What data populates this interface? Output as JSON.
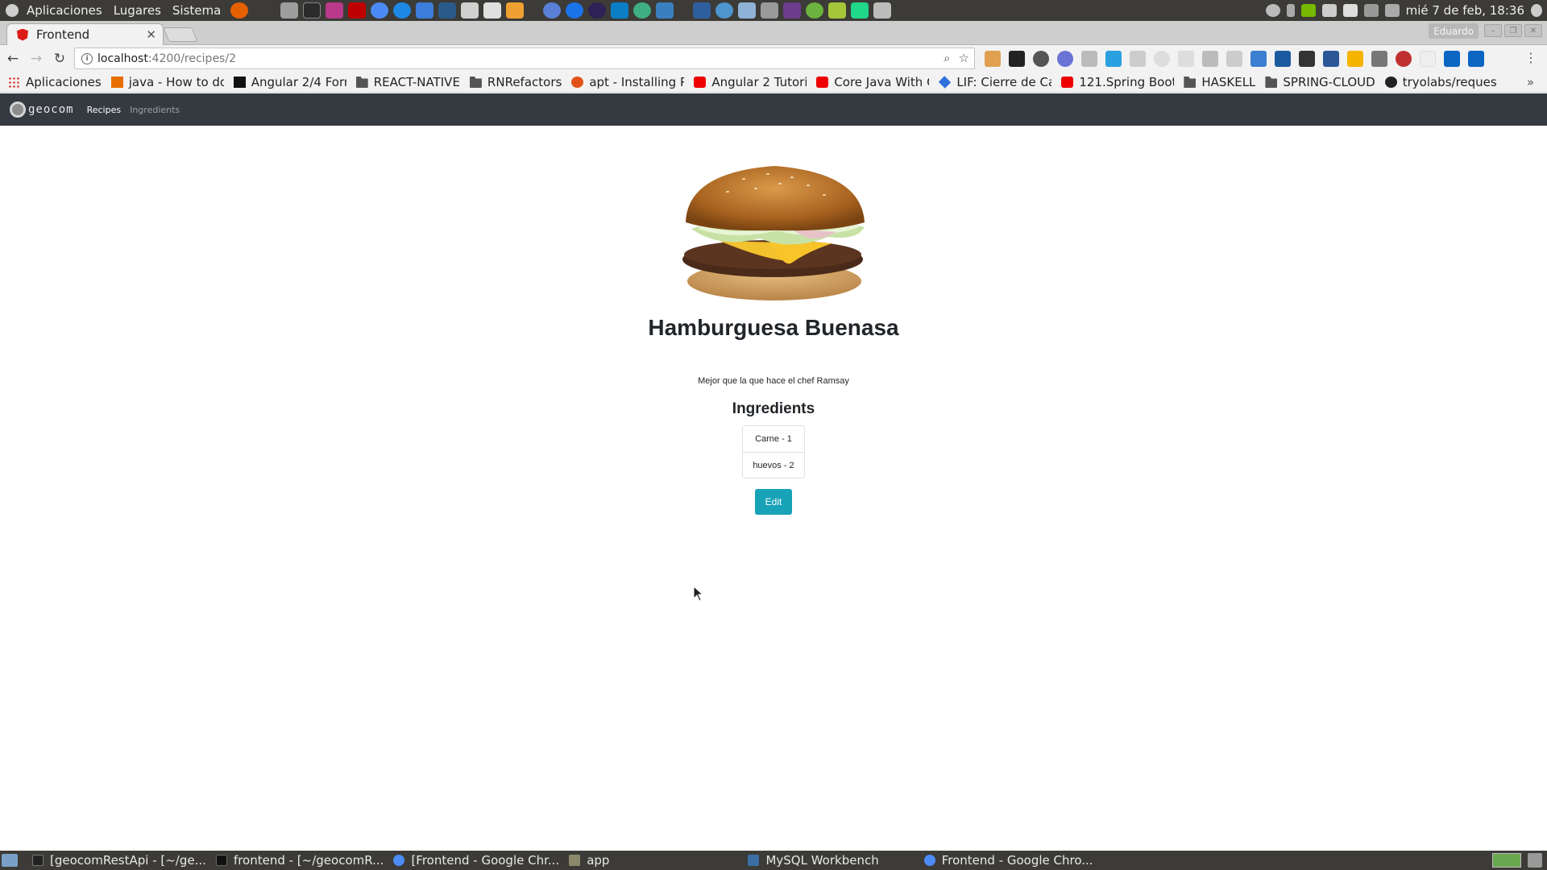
{
  "system_panel": {
    "menus": [
      "Aplicaciones",
      "Lugares",
      "Sistema"
    ],
    "clock": "mié  7 de feb, 18:36"
  },
  "browser": {
    "tab_title": "Frontend",
    "profile_name": "Eduardo",
    "url_host": "localhost",
    "url_path": ":4200/recipes/2"
  },
  "bookmarks": [
    {
      "label": "Aplicaciones",
      "icon": "apps-grid-icon"
    },
    {
      "label": "java - How to do",
      "icon": "java-icon"
    },
    {
      "label": "Angular 2/4 Forr",
      "icon": "cp-icon"
    },
    {
      "label": "REACT-NATIVE",
      "icon": "folder-icon"
    },
    {
      "label": "RNRefactors",
      "icon": "folder-icon"
    },
    {
      "label": "apt - Installing Pi",
      "icon": "askubuntu-icon"
    },
    {
      "label": "Angular 2 Tutori",
      "icon": "youtube-icon"
    },
    {
      "label": "Core Java With C",
      "icon": "youtube-icon"
    },
    {
      "label": "LIF: Cierre de Ca",
      "icon": "diamond-icon"
    },
    {
      "label": "121.Spring Boot",
      "icon": "youtube-icon"
    },
    {
      "label": "HASKELL",
      "icon": "folder-icon"
    },
    {
      "label": "SPRING-CLOUD",
      "icon": "folder-icon"
    },
    {
      "label": "tryolabs/reques",
      "icon": "github-icon"
    }
  ],
  "app_nav": {
    "brand": "geocom",
    "links": [
      "Recipes",
      "Ingredients"
    ]
  },
  "recipe": {
    "image": "hamburger-image",
    "name": "Hamburguesa Buenasa",
    "description": "Mejor que la que hace el chef Ramsay",
    "ingredients_heading": "Ingredients",
    "ingredients": [
      "Carne - 1",
      "huevos - 2"
    ],
    "edit_label": "Edit"
  },
  "taskbar": {
    "tasks": [
      {
        "label": "[geocomRestApi - [~/ge...",
        "icon": "intellij-icon"
      },
      {
        "label": "frontend - [~/geocomR...",
        "icon": "webstorm-icon"
      },
      {
        "label": "[Frontend - Google Chr...",
        "icon": "chrome-icon"
      },
      {
        "label": "app",
        "icon": "folder-icon"
      },
      {
        "label": "MySQL Workbench",
        "icon": "mysql-workbench-icon"
      },
      {
        "label": "Frontend - Google Chro...",
        "icon": "chrome-icon"
      }
    ]
  },
  "colors": {
    "app_navbar": "#343a40",
    "edit_button": "#17a2b8",
    "panel": "#3c3b37"
  }
}
